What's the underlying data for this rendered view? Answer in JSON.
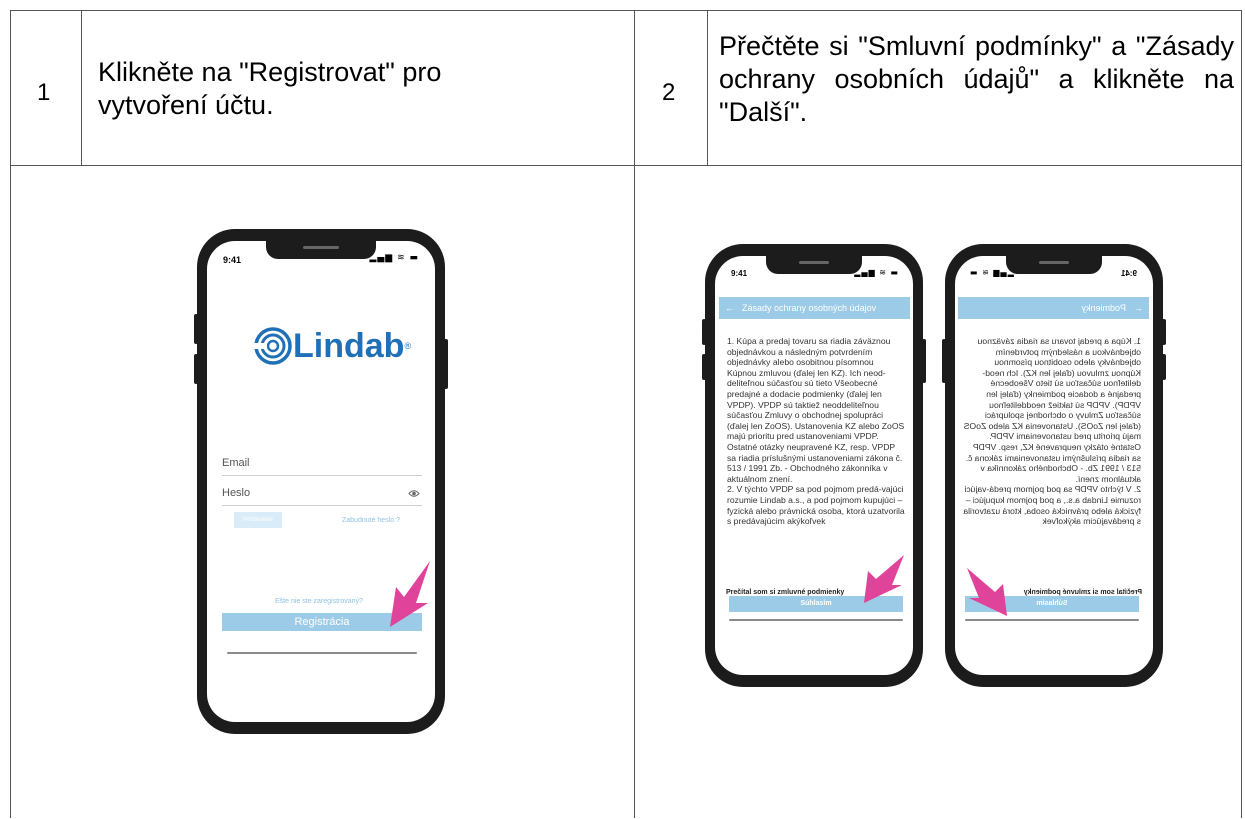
{
  "steps": [
    {
      "number": "1",
      "text": "Klikněte na \"Registrovat\" pro vytvoření účtu."
    },
    {
      "number": "2",
      "text": "Přečtěte si \"Smluvní podmínky\" a \"Zásady ochrany osobních údajů\" a klikněte na \"Další\"."
    }
  ],
  "phone1": {
    "time": "9:41",
    "logo": "Lindab",
    "logo_reg": "®",
    "email_label": "Email",
    "password_label": "Heslo",
    "login_button": "Prihlásenie",
    "forgot_link": "Zabudnuté heslo ?",
    "not_registered": "Ešte nie ste zaregistrovaný?",
    "register_button": "Registrácia",
    "eye_icon": "eye-icon"
  },
  "phone2": {
    "time": "9:41",
    "title": "Zásady ochrany osobných údajov",
    "terms": "1. Kúpa a predaj tovaru sa riadia záväznou objednávkou a následným potvrdením objednávky alebo osobitnou písomnou Kúpnou zmluvou (ďalej len KZ). Ich neod-deliteľnou súčasťou sú tieto Všeobecné predajné a dodacie podmienky (ďalej len VPDP). VPDP sú taktiež neoddeliteľnou súčasťou Zmluvy o obchodnej spolupráci (ďalej len ZoOS). Ustanovenia KZ alebo ZoOS majú prioritu pred ustanoveniami VPDP. Ostatné otázky neupravené KZ, resp. VPDP sa riadia príslušnými ustanoveniami zákona č. 513 / 1991 Zb. - Obchodného zákonníka v aktuálnom znení.\n2. V týchto VPDP sa pod pojmom predá-vajúci rozumie Lindab a.s., a pod pojmom kupujúci – fyzická alebo právnická osoba, ktorá uzatvorila s predávajúcim akýkoľvek",
    "checkbox_label": "Prečítal som si zmluvné podmienky",
    "agree_button": "Súhlasím"
  },
  "phone3": {
    "time": "9:41",
    "title": "Podmienky",
    "terms": "1. Kúpa a predaj tovaru sa riadia záväznou objednávkou a následným potvrdením objednávky alebo osobitnou písomnou Kúpnou zmluvou (ďalej len KZ). Ich neod-deliteľnou súčasťou sú tieto Všeobecné predajné a dodacie podmienky (ďalej len VPDP). VPDP sú taktiež neoddeliteľnou súčasťou Zmluvy o obchodnej spolupráci (ďalej len ZoOS). Ustanovenia KZ alebo ZoOS majú prioritu pred ustanoveniami VPDP. Ostatné otázky neupravené KZ, resp. VPDP sa riadia príslušnými ustanoveniami zákona č. 513 / 1991 Zb. - Obchodného zákonníka v aktuálnom znení.\n2. V týchto VPDP sa pod pojmom predá-vajúci rozumie Lindab a.s., a pod pojmom kupujúci – fyzická alebo právnická osoba, ktorá uzatvorila s predávajúcim akýkoľvek",
    "checkbox_label": "Prečítal som si zmluvné podmienky",
    "agree_button": "Súhlasím"
  },
  "colors": {
    "accent": "#9ccbe8",
    "brand": "#1f70b7",
    "arrow": "#e0449a",
    "border": "#555555"
  }
}
